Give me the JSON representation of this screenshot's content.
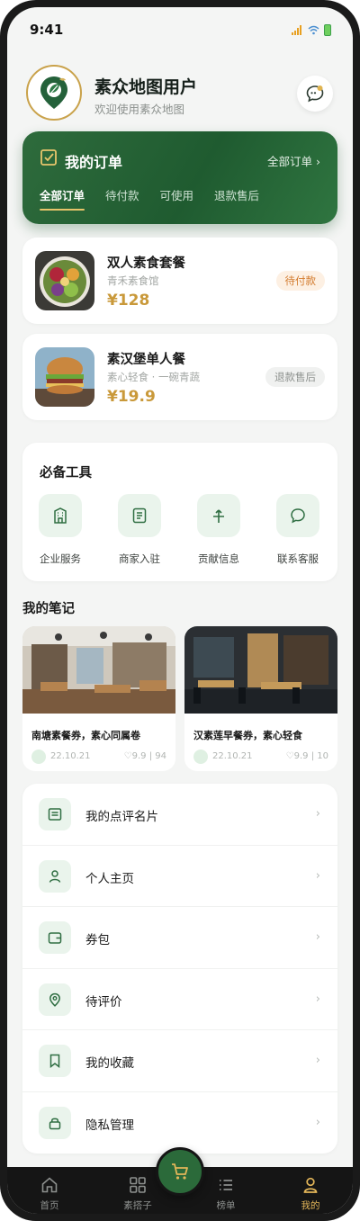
{
  "status": {
    "time": "9:41"
  },
  "profile": {
    "name": "素众地图用户",
    "subtitle": "欢迎使用素众地图"
  },
  "orders": {
    "title": "我的订单",
    "all_link": "全部订单 ›",
    "tabs": [
      "全部订单",
      "待付款",
      "可使用",
      "退款售后"
    ],
    "active_tab": 0,
    "items": [
      {
        "name": "双人素食套餐",
        "shop": "青禾素食馆",
        "price": "¥128",
        "status": "待付款"
      },
      {
        "name": "素汉堡单人餐",
        "shop": "素心轻食 · 一碗青蔬",
        "price": "¥19.9",
        "status": "退款售后"
      }
    ]
  },
  "tools": {
    "title": "必备工具",
    "items": [
      {
        "label": "企业服务",
        "icon": "building-icon"
      },
      {
        "label": "商家入驻",
        "icon": "document-icon"
      },
      {
        "label": "贡献信息",
        "icon": "sprout-icon"
      },
      {
        "label": "联系客服",
        "icon": "chat-icon"
      }
    ]
  },
  "notes": {
    "title": "我的笔记",
    "items": [
      {
        "title": "南塘素餐券，素心同属卷",
        "date": "22.10.21",
        "likes": "♡9.9",
        "count": "94"
      },
      {
        "title": "汉素莲早餐券，素心轻食",
        "date": "22.10.21",
        "likes": "♡9.9",
        "count": "10"
      }
    ]
  },
  "menu": {
    "items": [
      {
        "label": "我的点评名片",
        "icon": "card-icon"
      },
      {
        "label": "个人主页",
        "icon": "user-icon"
      },
      {
        "label": "券包",
        "icon": "wallet-icon"
      },
      {
        "label": "待评价",
        "icon": "location-icon"
      },
      {
        "label": "我的收藏",
        "icon": "bookmark-icon"
      },
      {
        "label": "隐私管理",
        "icon": "lock-icon"
      }
    ],
    "chevron": "›"
  },
  "tabbar": {
    "items": [
      {
        "label": "首页",
        "icon": "home-icon"
      },
      {
        "label": "素搭子",
        "icon": "grid-icon"
      },
      {
        "label": "榜单",
        "icon": "list-icon"
      },
      {
        "label": "我的",
        "icon": "person-icon"
      }
    ],
    "active": 3,
    "center_icon": "cart-icon"
  },
  "colors": {
    "brand": "#1f5b30",
    "accent_gold": "#c9993a",
    "tab_active": "#e3b659"
  }
}
